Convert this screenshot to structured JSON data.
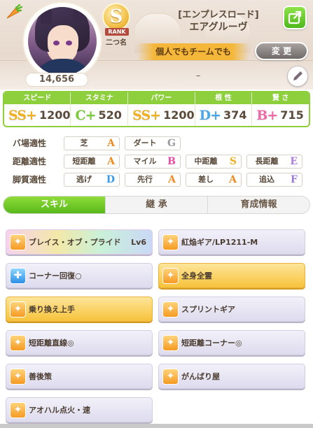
{
  "profile": {
    "fans": "14,656",
    "rank_letter": "S",
    "rank_ribbon": "RANK",
    "rank_sub": "二つ名",
    "epithet": "[エンプレスロード]",
    "name": "エアグルーヴ",
    "motto": "個人でもチームでも",
    "change_label": "変 更",
    "comment": "–"
  },
  "icons": {
    "carrot": "carrot-icon",
    "share": "share-icon",
    "edit": "pencil-icon"
  },
  "stats": [
    {
      "label": "スピード",
      "grade": "SS+",
      "value": "1200",
      "color": "#f0b020"
    },
    {
      "label": "スタミナ",
      "grade": "C+",
      "value": "520",
      "color": "#7ccc3a"
    },
    {
      "label": "パワー",
      "grade": "SS+",
      "value": "1200",
      "color": "#f0b020"
    },
    {
      "label": "根 性",
      "grade": "D+",
      "value": "374",
      "color": "#4aa8e8"
    },
    {
      "label": "賢 さ",
      "grade": "B+",
      "value": "715",
      "color": "#f06aa8"
    }
  ],
  "aptitudes": {
    "track": {
      "label": "バ場適性",
      "items": [
        {
          "name": "芝",
          "grade": "A",
          "color": "#f08a20"
        },
        {
          "name": "ダート",
          "grade": "G",
          "color": "#9a9a9a"
        }
      ]
    },
    "distance": {
      "label": "距離適性",
      "items": [
        {
          "name": "短距離",
          "grade": "A",
          "color": "#f08a20"
        },
        {
          "name": "マイル",
          "grade": "B",
          "color": "#e64aa8"
        },
        {
          "name": "中距離",
          "grade": "S",
          "color": "#f0b020"
        },
        {
          "name": "長距離",
          "grade": "E",
          "color": "#b07ae0"
        }
      ]
    },
    "style": {
      "label": "脚質適性",
      "items": [
        {
          "name": "逃げ",
          "grade": "D",
          "color": "#3a9ae8"
        },
        {
          "name": "先行",
          "grade": "A",
          "color": "#f08a20"
        },
        {
          "name": "差し",
          "grade": "A",
          "color": "#f08a20"
        },
        {
          "name": "追込",
          "grade": "F",
          "color": "#9a7ae0"
        }
      ]
    }
  },
  "tabs": [
    {
      "label": "スキル",
      "active": true
    },
    {
      "label": "継 承",
      "active": false
    },
    {
      "label": "育成情報",
      "active": false
    }
  ],
  "skills": [
    {
      "name": "ブレイス・オブ・プライド",
      "level": "Lv6",
      "kind": "unique",
      "icon": "speed-burst-icon"
    },
    {
      "name": "紅焔ギア/LP1211-M",
      "level": "",
      "kind": "normal",
      "icon": "speed-burst-icon"
    },
    {
      "name": "コーナー回復○",
      "level": "",
      "kind": "normal",
      "icon": "recovery-icon"
    },
    {
      "name": "全身全霊",
      "level": "",
      "kind": "gold",
      "icon": "speed-burst-icon"
    },
    {
      "name": "乗り換え上手",
      "level": "",
      "kind": "gold",
      "icon": "speed-burst-icon"
    },
    {
      "name": "スプリントギア",
      "level": "",
      "kind": "normal",
      "icon": "speed-burst-icon"
    },
    {
      "name": "短距離直線◎",
      "level": "",
      "kind": "normal",
      "icon": "speed-burst-icon"
    },
    {
      "name": "短距離コーナー◎",
      "level": "",
      "kind": "normal",
      "icon": "speed-burst-icon"
    },
    {
      "name": "善後策",
      "level": "",
      "kind": "normal",
      "icon": "speed-burst-icon"
    },
    {
      "name": "がんばり屋",
      "level": "",
      "kind": "normal",
      "icon": "speed-burst-icon"
    },
    {
      "name": "アオハル点火・速",
      "level": "",
      "kind": "normal",
      "icon": "speed-burst-icon"
    }
  ]
}
